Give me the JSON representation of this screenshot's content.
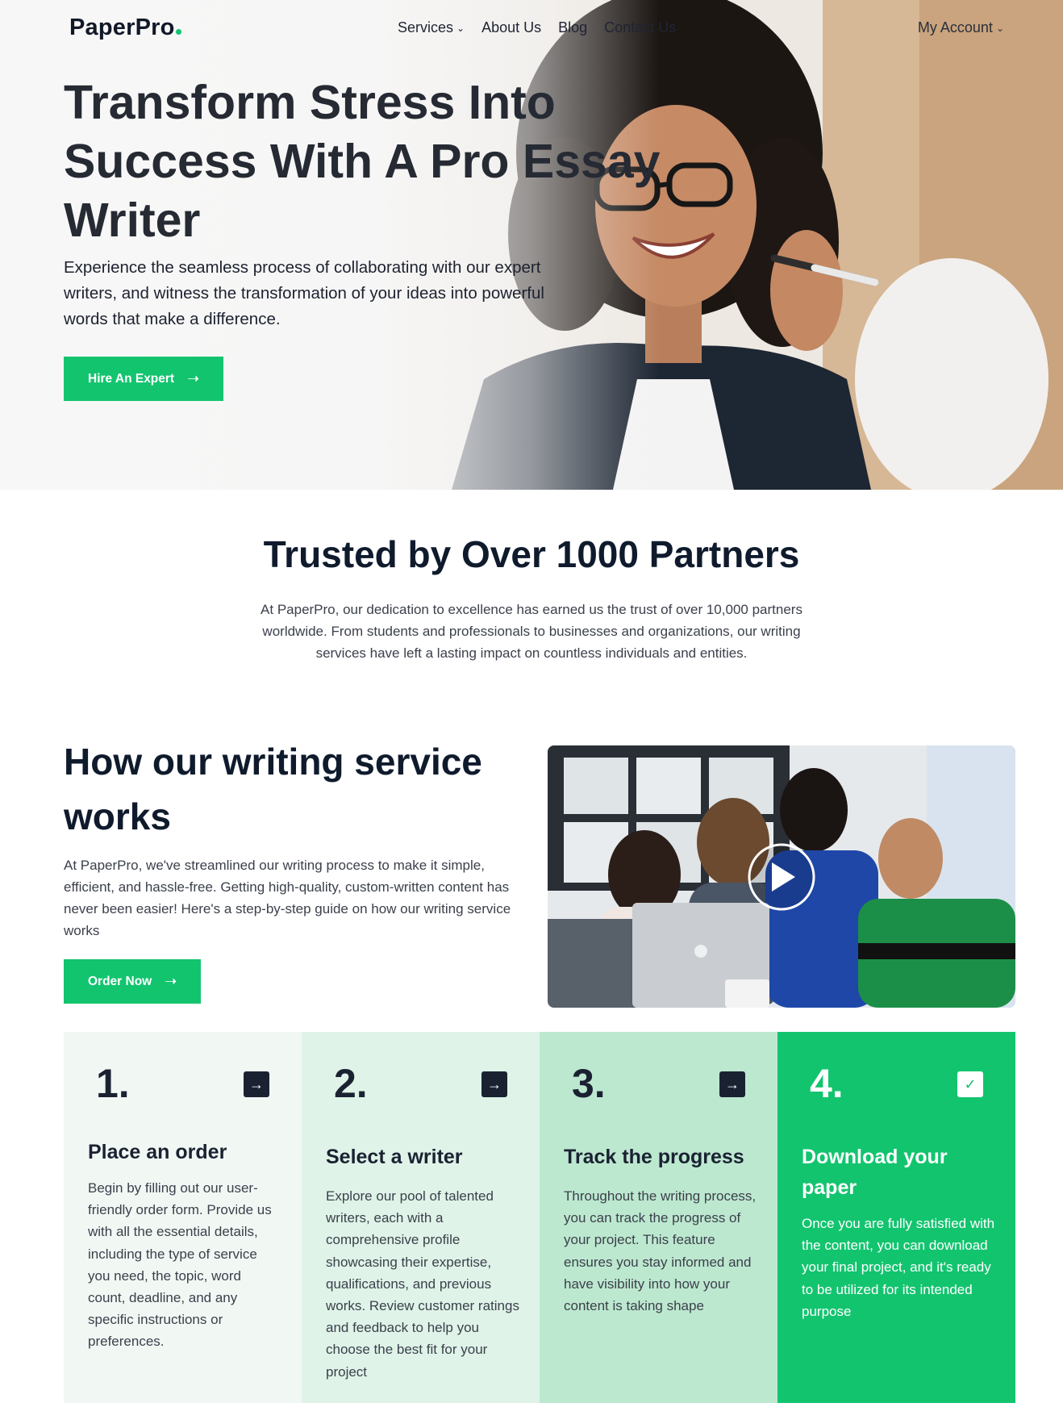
{
  "brand": {
    "name": "PaperPro",
    "accent": "#13c46f",
    "dark": "#0f1b2d"
  },
  "nav": {
    "items": [
      {
        "label": "Services",
        "has_dropdown": true
      },
      {
        "label": "About Us",
        "has_dropdown": false
      },
      {
        "label": "Blog",
        "has_dropdown": false
      },
      {
        "label": "Contact Us",
        "has_dropdown": false
      }
    ],
    "account_label": "My Account"
  },
  "hero": {
    "title": "Transform Stress Into Success With A Pro Essay Writer",
    "subtitle": "Experience the seamless process of collaborating with our expert writers, and witness the transformation of your ideas into powerful words that make a difference.",
    "cta_label": "Hire An Expert",
    "cta_icon": "arrow-right-icon"
  },
  "trusted": {
    "title": "Trusted by Over 1000 Partners",
    "text": "At PaperPro, our dedication to excellence has earned us the trust of over 10,000 partners worldwide. From students and professionals to businesses and organizations, our writing services have left a lasting impact on countless individuals and entities."
  },
  "how": {
    "title": "How our writing service works",
    "text": "At PaperPro, we've streamlined our writing process to make it simple, efficient, and hassle-free. Getting high-quality, custom-written content has never been easier! Here's a step-by-step guide on how our writing service works",
    "cta_label": "Order Now",
    "video_icon": "play-icon"
  },
  "steps": [
    {
      "number": "1.",
      "title": "Place an order",
      "icon": "arrow-right-icon",
      "text": "Begin by filling out our user-friendly order form. Provide us with all the essential details, including the type of service you need, the topic, word count, deadline, and any specific instructions or preferences."
    },
    {
      "number": "2.",
      "title": "Select a writer",
      "icon": "arrow-right-icon",
      "text": "Explore our pool of talented writers, each with a comprehensive profile showcasing their expertise, qualifications, and previous works. Review customer ratings and feedback to help you choose the best fit for your project"
    },
    {
      "number": "3.",
      "title": "Track the progress",
      "icon": "arrow-right-icon",
      "text": "Throughout the writing process, you can track the progress of your project. This feature ensures you stay informed and have visibility into how your content is taking shape"
    },
    {
      "number": "4.",
      "title": "Download your paper",
      "icon": "check-icon",
      "text": "Once you are fully satisfied with the content, you can download your final project, and it's ready to be utilized for its intended purpose"
    }
  ]
}
